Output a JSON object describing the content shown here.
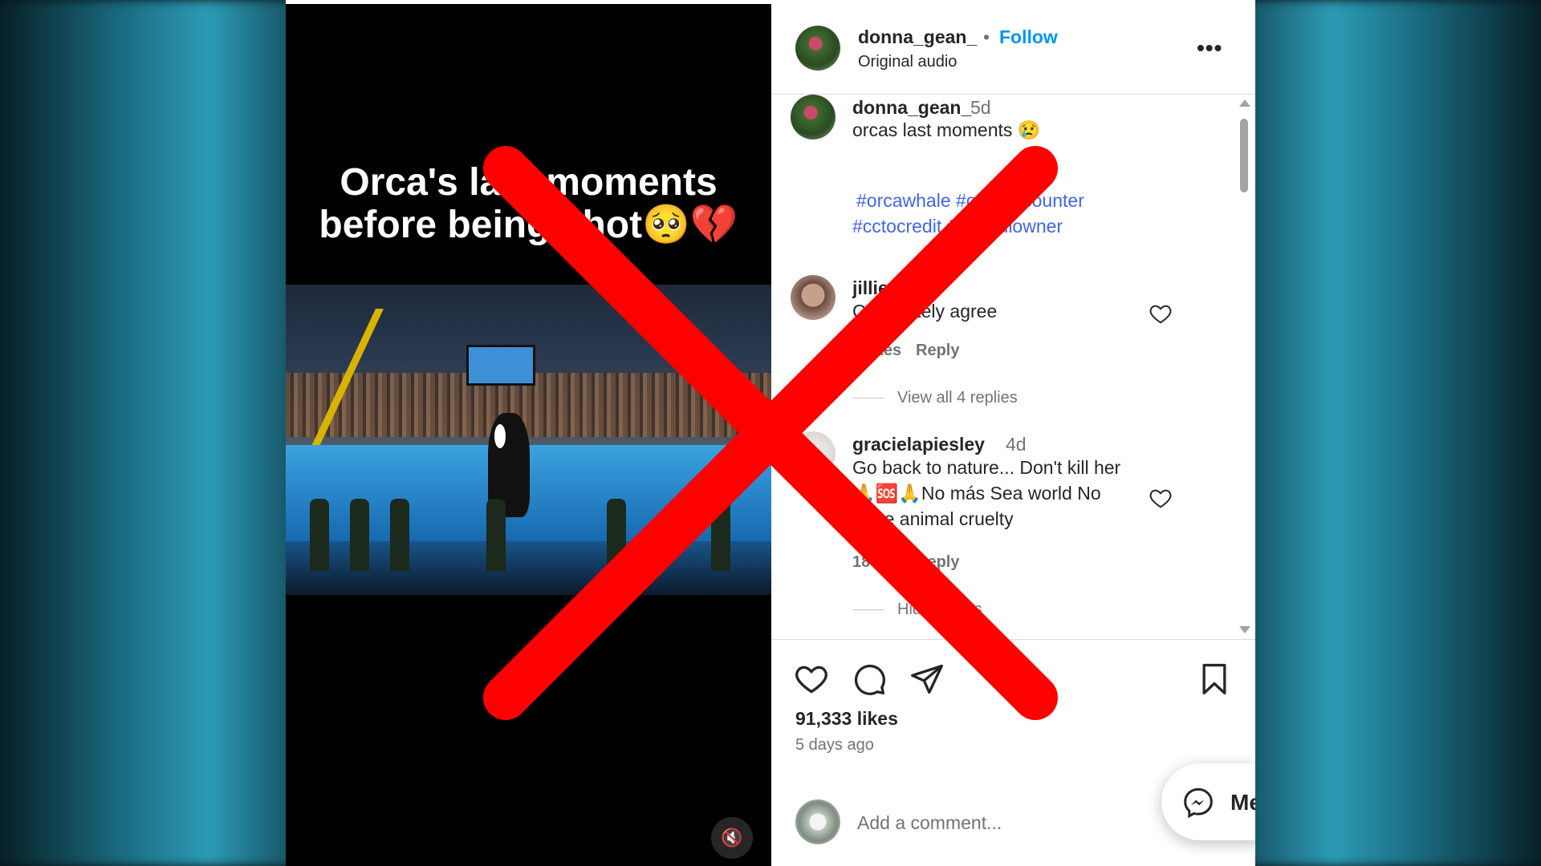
{
  "video": {
    "caption_line1": "Orca's last moments",
    "caption_line2": "before being shot🥺💔",
    "mute_icon": "🔇"
  },
  "post": {
    "header_username": "donna_gean_",
    "header_dot": "•",
    "follow_label": "Follow",
    "audio_label": "Original audio",
    "more_icon": "•••"
  },
  "caption": {
    "username": "donna_gean_",
    "time": "5d",
    "text": "orcas last moments 😢",
    "hashtags_line1": "#orcawhale #orcaencounter",
    "hashtags_line2": "#cctocredit #rightfulowner"
  },
  "comments": [
    {
      "username": "jillie",
      "time": "5d",
      "text": "Completely agree",
      "likes": "7 likes",
      "reply_label": "Reply",
      "view_replies": "View all 4 replies"
    },
    {
      "username": "gracielapiesley",
      "time": "4d",
      "text_line1": "Go back to nature... Don't kill her",
      "text_line2": "🙏🆘🙏No más Sea world No",
      "text_line3": "more animal cruelty",
      "likes": "18 likes",
      "reply_label": "Reply",
      "view_replies": "Hide replies"
    }
  ],
  "actions": {
    "likes_count": "91,333 likes",
    "posted_ago": "5 days ago"
  },
  "add_comment": {
    "placeholder": "Add a comment..."
  },
  "messages": {
    "label": "Me"
  },
  "colors": {
    "follow_blue": "#0095f6",
    "hashtag_blue": "#4263eb",
    "x_red": "#ff0000"
  }
}
